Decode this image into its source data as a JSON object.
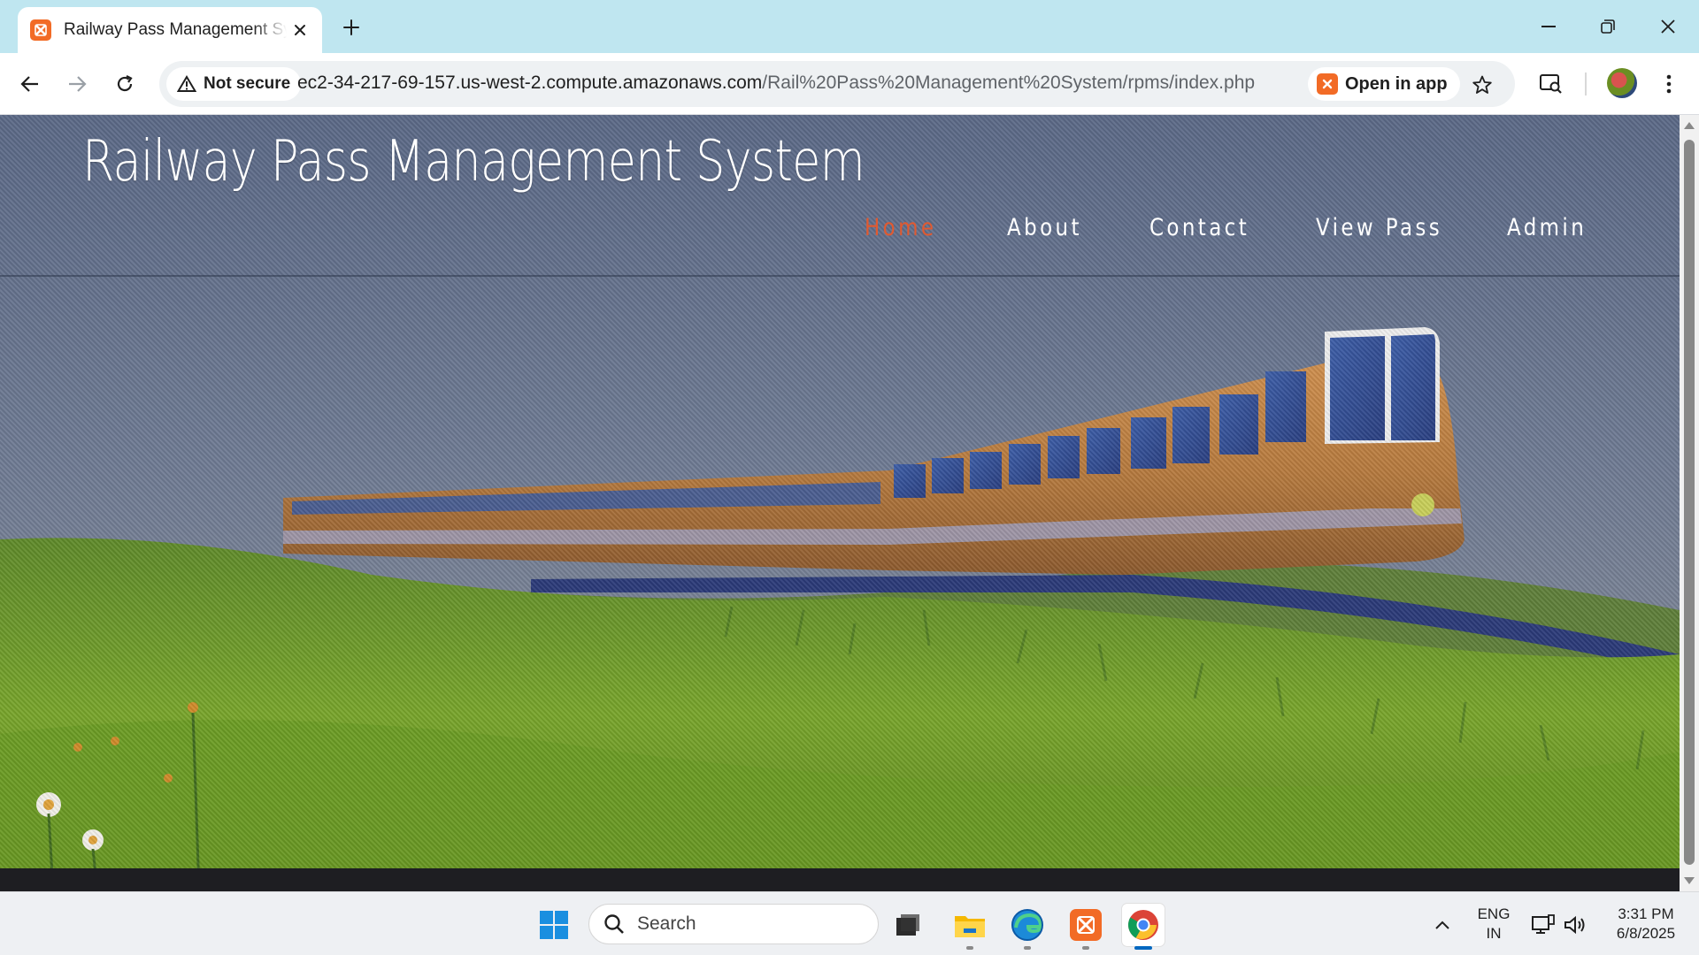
{
  "browser": {
    "tab_title": "Railway Pass Management System",
    "security_label": "Not secure",
    "url_host": "ec2-34-217-69-157.us-west-2.compute.amazonaws.com",
    "url_path": "/Rail%20Pass%20Management%20System/rpms/index.php",
    "open_in_app_label": "Open in app"
  },
  "site": {
    "title": "Railway Pass Management System",
    "nav": [
      "Home",
      "About",
      "Contact",
      "View Pass",
      "Admin"
    ],
    "active_nav": "Home"
  },
  "taskbar": {
    "search_placeholder": "Search",
    "language": "ENG",
    "region": "IN",
    "time": "3:31 PM",
    "date": "6/8/2025"
  },
  "colors": {
    "nav_active": "#e05a31",
    "header_bg": "#5e6d89",
    "grass": "#6f9a2a",
    "train": "#c98a4a"
  },
  "icons": [
    "xampp-icon",
    "close-icon",
    "plus-icon",
    "minimize-icon",
    "restore-icon",
    "back-icon",
    "forward-icon",
    "reload-icon",
    "warning-icon",
    "star-icon",
    "media-search-icon",
    "avatar",
    "menu-icon",
    "windows-icon",
    "search-icon",
    "task-view-icon",
    "file-explorer-icon",
    "edge-icon",
    "chrome-icon",
    "chevron-up-icon",
    "network-icon",
    "volume-icon"
  ]
}
